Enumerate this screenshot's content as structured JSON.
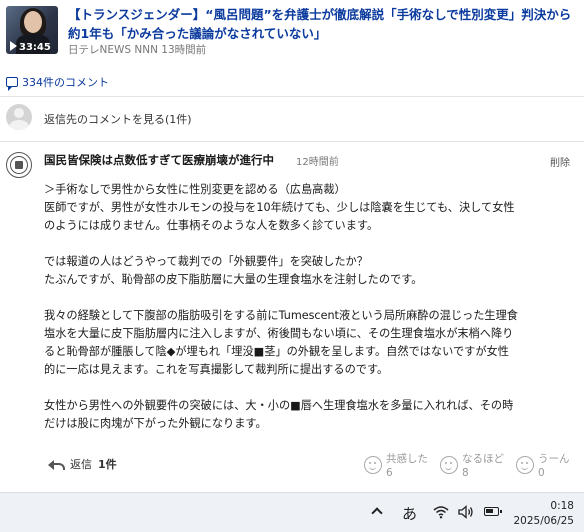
{
  "article": {
    "title_line1": "【トランスジェンダー】“風呂問題”を弁護士が徹底解説「手術なしで性別変更」判決から",
    "title_line2": "約1年も「かみ合った議論がなされていない」",
    "source": "日テレNEWS NNN",
    "time": "13時間前",
    "video_duration": "33:45"
  },
  "comments": {
    "count_label": "334件のコメント"
  },
  "parent": {
    "link_label": "返信先のコメントを見る(1件)"
  },
  "reply": {
    "username": "国民皆保険は点数低すぎて医療崩壊が進行中",
    "time": "12時間前",
    "delete_label": "削除",
    "lines": [
      "＞手術なしで男性から女性に性別変更を認める（広島高裁）",
      "医師ですが、男性が女性ホルモンの投与を10年続けても、少しは陰嚢を生じても、決して女性",
      "のようには成りません。仕事柄そのような人を数多く診ています。",
      "",
      "では報道の人はどうやって裁判での「外観要件」を突破したか？",
      "たぶんですが、恥骨部の皮下脂肪層に大量の生理食塩水を注射したのです。",
      "",
      "我々の経験として下腹部の脂肪吸引をする前にTumescent液という局所麻酔の混じった生理食",
      "塩水を大量に皮下脂肪層内に注入しますが、術後間もない頃に、その生理食塩水が末梢へ降り",
      "ると恥骨部が腫脹して陰◆が埋もれ「埋没■茎」の外観を呈します。自然ではないですが女性",
      "的に一応は見えます。これを写真撮影して裁判所に提出するのです。",
      "",
      "女性から男性への外観要件の突破には、大・小の■唇へ生理食塩水を多量に入れれば、その時",
      "だけは股に肉塊が下がった外観になります。"
    ],
    "reply_label": "返信",
    "reply_count": "1件",
    "reactions": [
      {
        "label": "共感した",
        "count": "6"
      },
      {
        "label": "なるほど",
        "count": "8"
      },
      {
        "label": "うーん",
        "count": "0"
      }
    ]
  },
  "taskbar": {
    "ime_label": "あ",
    "battery_level": 0.7,
    "time": "0:18",
    "date": "2025/06/25"
  }
}
